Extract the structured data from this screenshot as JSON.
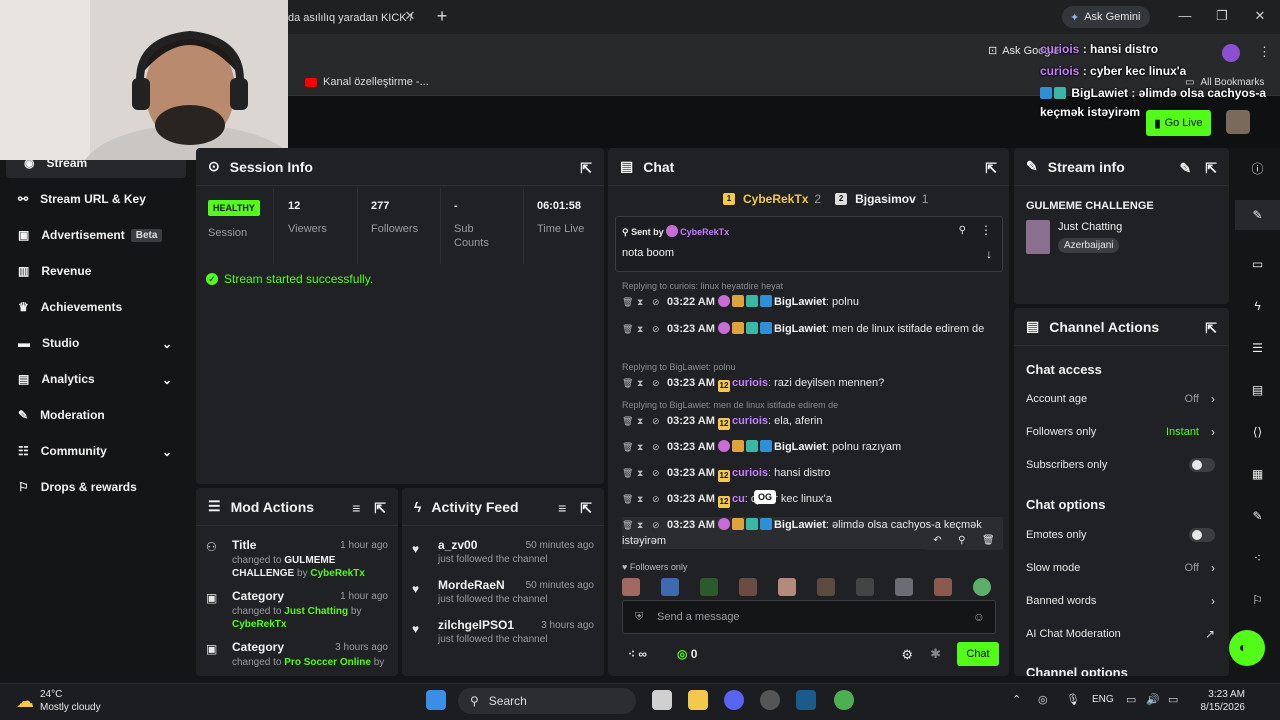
{
  "browser": {
    "tab_title": "da asılılıq yaradan KICK /",
    "ask_gemini": "Ask Gemini",
    "ask_google": "Ask Google",
    "bookmark_yt": "Kanal özelleştirme -...",
    "all_bookmarks": "All Bookmarks",
    "go_live": "Go Live"
  },
  "overlay_chat": [
    {
      "user": "curiois",
      "text": " : hansi distro"
    },
    {
      "user": "curiois",
      "text": " : cyber kec linux'a"
    },
    {
      "user": "BigLawiet",
      "text": " : əlimdə olsa cachyos-a"
    },
    {
      "user": "",
      "text": "keçmək istəyirəm"
    }
  ],
  "sidebar": {
    "items": [
      {
        "label": "Stream"
      },
      {
        "label": "Stream URL & Key"
      },
      {
        "label": "Advertisement",
        "badge": "Beta"
      },
      {
        "label": "Revenue"
      },
      {
        "label": "Achievements"
      },
      {
        "label": "Studio"
      },
      {
        "label": "Analytics"
      },
      {
        "label": "Moderation"
      },
      {
        "label": "Community"
      },
      {
        "label": "Drops & rewards"
      }
    ]
  },
  "session": {
    "title": "Session Info",
    "health": "HEALTHY",
    "health_label": "Session",
    "viewers": "12",
    "viewers_label": "Viewers",
    "followers": "277",
    "followers_label": "Followers",
    "subs": "-",
    "subs_label": "Sub Counts",
    "time": "06:01:58",
    "time_label": "Time Live",
    "status": "Stream started successfully."
  },
  "mod_actions": {
    "title": "Mod Actions",
    "items": [
      {
        "title": "Title",
        "time": "1 hour ago",
        "pre": "changed to ",
        "value": "GULMEME CHALLENGE",
        "by_pre": " by ",
        "by": "CybeRekTx"
      },
      {
        "title": "Category",
        "time": "1 hour ago",
        "pre": "changed to ",
        "value": "Just Chatting",
        "by_pre": " by ",
        "by": "CybeRekTx"
      },
      {
        "title": "Category",
        "time": "3 hours ago",
        "pre": "changed to ",
        "value": "Pro Soccer Online",
        "by_pre": " by ",
        "by": ""
      }
    ]
  },
  "activity": {
    "title": "Activity Feed",
    "items": [
      {
        "name": "a_zv00",
        "time": "50 minutes ago",
        "desc": "just followed the channel"
      },
      {
        "name": "MordeRaeN",
        "time": "50 minutes ago",
        "desc": "just followed the channel"
      },
      {
        "name": "zilchgelPSO1",
        "time": "3 hours ago",
        "desc": "just followed the channel"
      }
    ]
  },
  "chat": {
    "title": "Chat",
    "top1_name": "CybeRekTx",
    "top1_count": "2",
    "top2_name": "Bjgasimov",
    "top2_count": "1",
    "pinned_sent_by": "Sent by",
    "pinned_user": "CybeRekTx",
    "pinned_text": "nota boom",
    "messages": [
      {
        "reply": "Replying to curiois: linux heyatdire heyat",
        "time": "03:22 AM",
        "user": "BigLawiet",
        "text": ": polnu"
      },
      {
        "reply": "",
        "time": "03:23 AM",
        "user": "BigLawiet",
        "text": ": men de linux istifade edirem de"
      },
      {
        "reply": "Replying to BigLawiet: polnu",
        "time": "03:23 AM",
        "user": "curiois",
        "text": ": razi deyilsen mennen?"
      },
      {
        "reply": "Replying to BigLawiet: men de linux istifade edirem de",
        "time": "03:23 AM",
        "user": "curiois",
        "text": ": ela, aferin"
      },
      {
        "reply": "",
        "time": "03:23 AM",
        "user": "BigLawiet",
        "text": ": polnu razıyam"
      },
      {
        "reply": "",
        "time": "03:23 AM",
        "user": "curiois",
        "text": ": hansi distro"
      },
      {
        "reply": "",
        "time": "03:23 AM",
        "user": "cu",
        "text": ": cyber kec linux'a"
      },
      {
        "reply": "",
        "time": "03:23 AM",
        "user": "BigLawiet",
        "text": ": əlimdə olsa cachyos-a keçmək istəyirəm"
      }
    ],
    "og_tooltip": "OG",
    "followers_only": "Followers only",
    "placeholder": "Send a message",
    "infinite_count": "∞",
    "points": "0",
    "send": "Chat"
  },
  "stream_info": {
    "title": "Stream info",
    "stream_title": "GULMEME CHALLENGE",
    "category": "Just Chatting",
    "tag": "Azerbaijani"
  },
  "channel_actions": {
    "title": "Channel Actions",
    "chat_access": "Chat access",
    "account_age": "Account age",
    "account_age_val": "Off",
    "followers_only": "Followers only",
    "followers_only_val": "Instant",
    "subscribers_only": "Subscribers only",
    "chat_options": "Chat options",
    "emotes_only": "Emotes only",
    "slow_mode": "Slow mode",
    "slow_mode_val": "Off",
    "banned_words": "Banned words",
    "ai_moderation": "AI Chat Moderation",
    "channel_options": "Channel options"
  },
  "taskbar": {
    "temp": "24°C",
    "weather": "Mostly cloudy",
    "search": "Search",
    "lang": "ENG",
    "time": "3:23 AM",
    "date": "8/15/2026"
  },
  "colors": {
    "accent": "#53fc18",
    "purple_user": "#c77dff",
    "panel": "#1f2124"
  }
}
